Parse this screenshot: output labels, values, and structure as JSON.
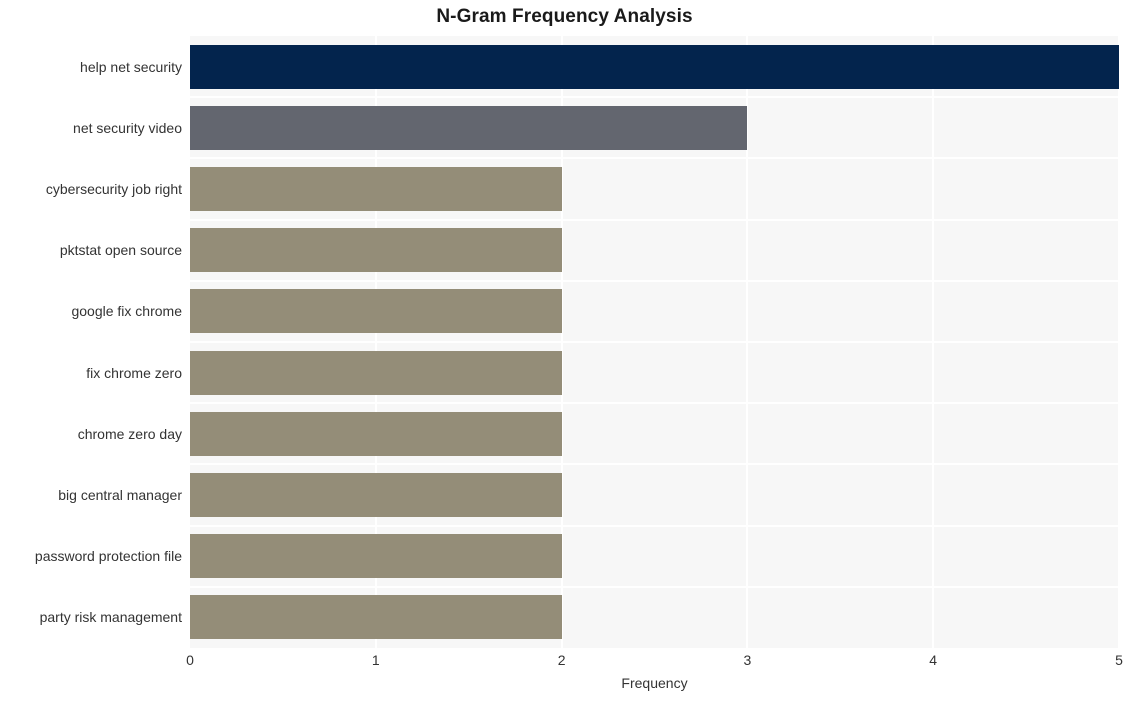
{
  "chart_data": {
    "type": "bar",
    "orientation": "horizontal",
    "title": "N-Gram Frequency Analysis",
    "xlabel": "Frequency",
    "ylabel": "",
    "categories": [
      "help net security",
      "net security video",
      "cybersecurity job right",
      "pktstat open source",
      "google fix chrome",
      "fix chrome zero",
      "chrome zero day",
      "big central manager",
      "password protection file",
      "party risk management"
    ],
    "values": [
      5,
      3,
      2,
      2,
      2,
      2,
      2,
      2,
      2,
      2
    ],
    "bar_colors": [
      "#03244d",
      "#63666f",
      "#948d78",
      "#948d78",
      "#948d78",
      "#948d78",
      "#948d78",
      "#948d78",
      "#948d78",
      "#948d78"
    ],
    "xlim": [
      0,
      5
    ],
    "xticks": [
      0,
      1,
      2,
      3,
      4,
      5
    ],
    "xtick_labels": [
      "0",
      "1",
      "2",
      "3",
      "4",
      "5"
    ],
    "grid": true,
    "grid_color": "#ffffff",
    "plot_background": "#f7f7f7",
    "figure_background": "#ffffff",
    "legend": null
  }
}
